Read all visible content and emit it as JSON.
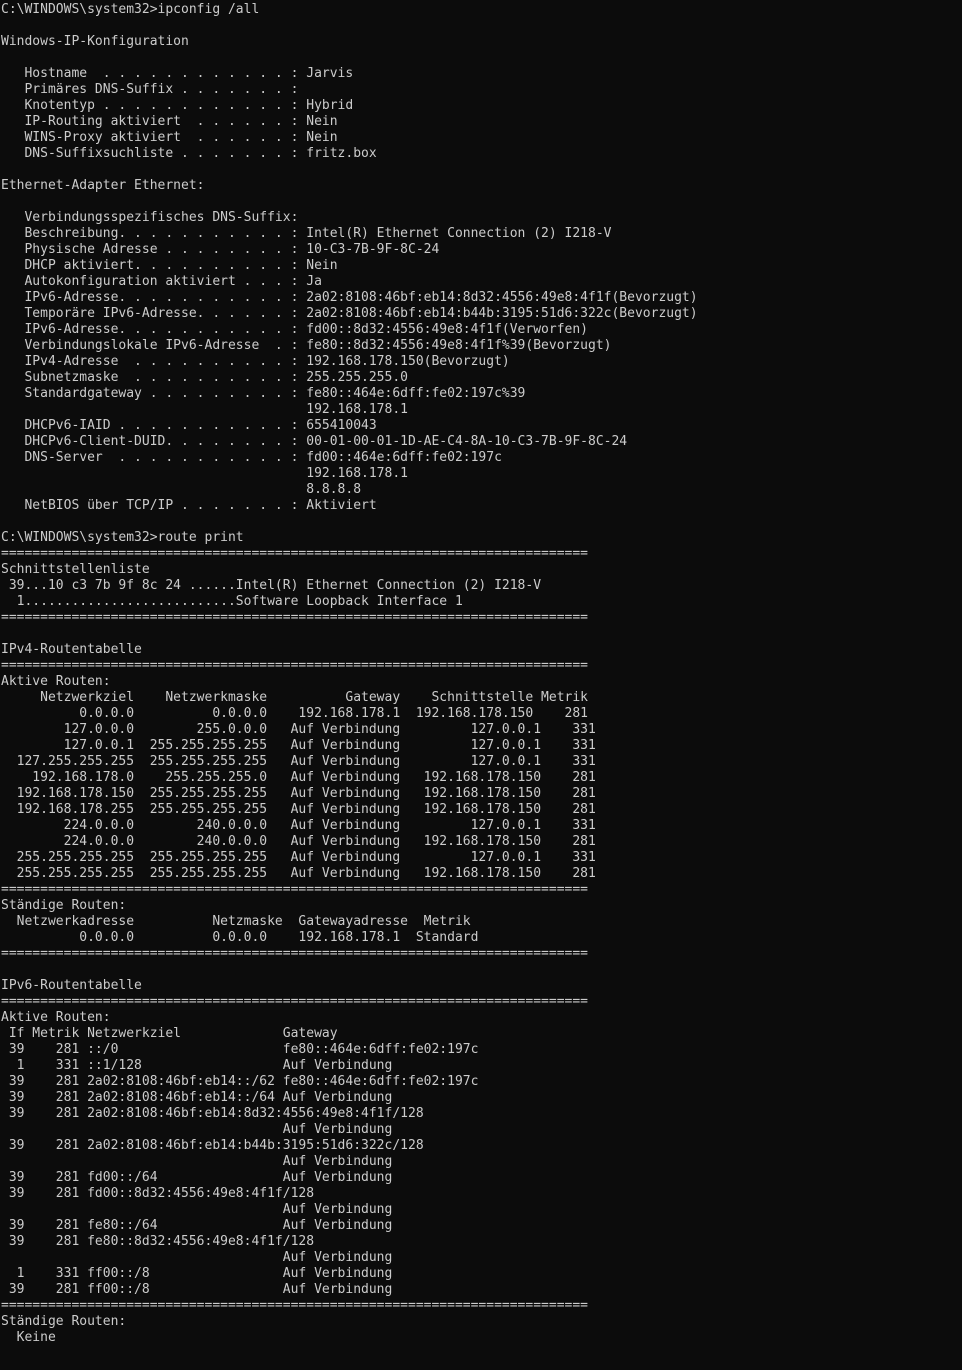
{
  "console": {
    "lines": [
      "C:\\WINDOWS\\system32>ipconfig /all",
      "",
      "Windows-IP-Konfiguration",
      "",
      "   Hostname  . . . . . . . . . . . . : Jarvis",
      "   Primäres DNS-Suffix . . . . . . . :",
      "   Knotentyp . . . . . . . . . . . . : Hybrid",
      "   IP-Routing aktiviert  . . . . . . : Nein",
      "   WINS-Proxy aktiviert  . . . . . . : Nein",
      "   DNS-Suffixsuchliste . . . . . . . : fritz.box",
      "",
      "Ethernet-Adapter Ethernet:",
      "",
      "   Verbindungsspezifisches DNS-Suffix:",
      "   Beschreibung. . . . . . . . . . . : Intel(R) Ethernet Connection (2) I218-V",
      "   Physische Adresse . . . . . . . . : 10-C3-7B-9F-8C-24",
      "   DHCP aktiviert. . . . . . . . . . : Nein",
      "   Autokonfiguration aktiviert . . . : Ja",
      "   IPv6-Adresse. . . . . . . . . . . : 2a02:8108:46bf:eb14:8d32:4556:49e8:4f1f(Bevorzugt)",
      "   Temporäre IPv6-Adresse. . . . . . : 2a02:8108:46bf:eb14:b44b:3195:51d6:322c(Bevorzugt)",
      "   IPv6-Adresse. . . . . . . . . . . : fd00::8d32:4556:49e8:4f1f(Verworfen)",
      "   Verbindungslokale IPv6-Adresse  . : fe80::8d32:4556:49e8:4f1f%39(Bevorzugt)",
      "   IPv4-Adresse  . . . . . . . . . . : 192.168.178.150(Bevorzugt)",
      "   Subnetzmaske  . . . . . . . . . . : 255.255.255.0",
      "   Standardgateway . . . . . . . . . : fe80::464e:6dff:fe02:197c%39",
      "                                       192.168.178.1",
      "   DHCPv6-IAID . . . . . . . . . . . : 655410043",
      "   DHCPv6-Client-DUID. . . . . . . . : 00-01-00-01-1D-AE-C4-8A-10-C3-7B-9F-8C-24",
      "   DNS-Server  . . . . . . . . . . . : fd00::464e:6dff:fe02:197c",
      "                                       192.168.178.1",
      "                                       8.8.8.8",
      "   NetBIOS über TCP/IP . . . . . . . : Aktiviert",
      "",
      "C:\\WINDOWS\\system32>route print",
      "===========================================================================",
      "Schnittstellenliste",
      " 39...10 c3 7b 9f 8c 24 ......Intel(R) Ethernet Connection (2) I218-V",
      "  1...........................Software Loopback Interface 1",
      "===========================================================================",
      "",
      "IPv4-Routentabelle",
      "===========================================================================",
      "Aktive Routen:",
      "     Netzwerkziel    Netzwerkmaske          Gateway    Schnittstelle Metrik",
      "          0.0.0.0          0.0.0.0    192.168.178.1  192.168.178.150    281",
      "        127.0.0.0        255.0.0.0   Auf Verbindung         127.0.0.1    331",
      "        127.0.0.1  255.255.255.255   Auf Verbindung         127.0.0.1    331",
      "  127.255.255.255  255.255.255.255   Auf Verbindung         127.0.0.1    331",
      "    192.168.178.0    255.255.255.0   Auf Verbindung   192.168.178.150    281",
      "  192.168.178.150  255.255.255.255   Auf Verbindung   192.168.178.150    281",
      "  192.168.178.255  255.255.255.255   Auf Verbindung   192.168.178.150    281",
      "        224.0.0.0        240.0.0.0   Auf Verbindung         127.0.0.1    331",
      "        224.0.0.0        240.0.0.0   Auf Verbindung   192.168.178.150    281",
      "  255.255.255.255  255.255.255.255   Auf Verbindung         127.0.0.1    331",
      "  255.255.255.255  255.255.255.255   Auf Verbindung   192.168.178.150    281",
      "===========================================================================",
      "Ständige Routen:",
      "  Netzwerkadresse          Netzmaske  Gatewayadresse  Metrik",
      "          0.0.0.0          0.0.0.0    192.168.178.1  Standard",
      "===========================================================================",
      "",
      "IPv6-Routentabelle",
      "===========================================================================",
      "Aktive Routen:",
      " If Metrik Netzwerkziel             Gateway",
      " 39    281 ::/0                     fe80::464e:6dff:fe02:197c",
      "  1    331 ::1/128                  Auf Verbindung",
      " 39    281 2a02:8108:46bf:eb14::/62 fe80::464e:6dff:fe02:197c",
      " 39    281 2a02:8108:46bf:eb14::/64 Auf Verbindung",
      " 39    281 2a02:8108:46bf:eb14:8d32:4556:49e8:4f1f/128",
      "                                    Auf Verbindung",
      " 39    281 2a02:8108:46bf:eb14:b44b:3195:51d6:322c/128",
      "                                    Auf Verbindung",
      " 39    281 fd00::/64                Auf Verbindung",
      " 39    281 fd00::8d32:4556:49e8:4f1f/128",
      "                                    Auf Verbindung",
      " 39    281 fe80::/64                Auf Verbindung",
      " 39    281 fe80::8d32:4556:49e8:4f1f/128",
      "                                    Auf Verbindung",
      "  1    331 ff00::/8                 Auf Verbindung",
      " 39    281 ff00::/8                 Auf Verbindung",
      "===========================================================================",
      "Ständige Routen:",
      "  Keine"
    ]
  }
}
